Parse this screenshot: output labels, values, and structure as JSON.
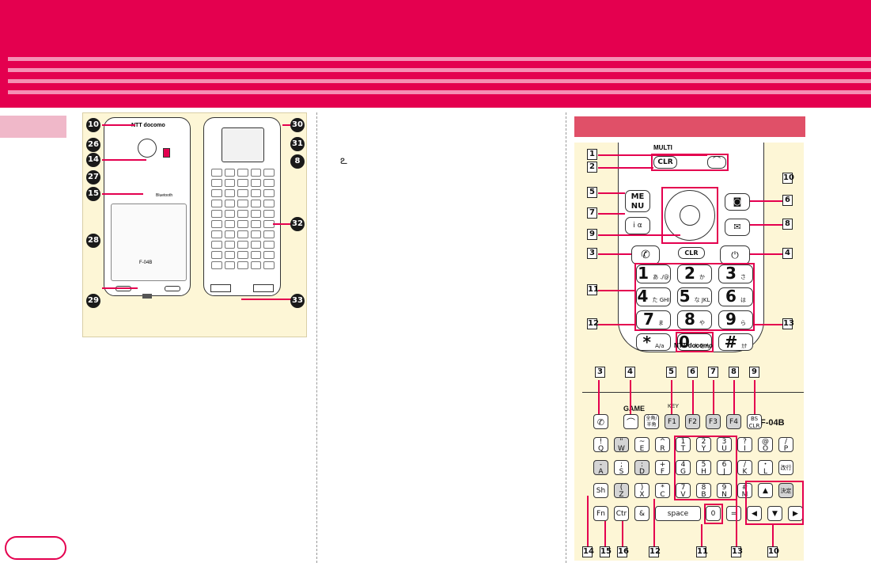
{
  "page": {
    "model_label_back": "F-04B",
    "brand_label": "NTT docomo",
    "bluetooth_label": "Bluetooth",
    "multi_label": "MULTI",
    "keyboard_model": "F-04B"
  },
  "back_view_callouts": [
    {
      "n": "10"
    },
    {
      "n": "26"
    },
    {
      "n": "14"
    },
    {
      "n": "27"
    },
    {
      "n": "15"
    },
    {
      "n": "28"
    },
    {
      "n": "29"
    },
    {
      "n": "30"
    },
    {
      "n": "31"
    },
    {
      "n": "8"
    },
    {
      "n": "32"
    },
    {
      "n": "33"
    }
  ],
  "keypad_tags": {
    "t1": "1",
    "t2": "2",
    "t3": "3",
    "t4": "4",
    "t5": "5",
    "t6": "6",
    "t7": "7",
    "t8": "8",
    "t9": "9",
    "t10": "10",
    "t11": "11",
    "t12": "12",
    "t13": "13"
  },
  "keypad_keys": {
    "clr": "CLR",
    "menu": "ME NU",
    "clr2": "CLR",
    "k1": "1",
    "k2": "2",
    "k3": "3",
    "k4": "4",
    "k5": "5",
    "k6": "6",
    "k7": "7",
    "k8": "8",
    "k9": "9",
    "k0": "0",
    "kstar": "*",
    "khash": "#",
    "sub1": "あ ./@",
    "sub2": "か ABC",
    "sub3": "さ DEF",
    "sub4": "た GHI",
    "sub5": "な JKL",
    "sub6": "は MNO",
    "sub7": "ま PQRS",
    "sub8": "や TUV",
    "sub9": "ら WXYZ",
    "sub0": "わをん",
    "substar": "A/a",
    "subhash": "ｶﾅ"
  },
  "qwerty_tags": {
    "q3": "3",
    "q4": "4",
    "q5": "5",
    "q6": "6",
    "q7": "7",
    "q8": "8",
    "q9": "9",
    "b14": "14",
    "b15": "15",
    "b16": "16",
    "b12": "12",
    "b11": "11",
    "b13": "13",
    "b10": "10"
  },
  "qwerty": {
    "game_label": "GAME",
    "key_label": "KEY",
    "zenkaku": "全角/半角",
    "f1": "F1",
    "f2": "F2",
    "f3": "F3",
    "f4": "F4",
    "bs": "BS CLR",
    "row1": [
      "Q",
      "W",
      "E",
      "R",
      "T",
      "Y",
      "U",
      "I",
      "O",
      "P"
    ],
    "row1_top": [
      "!",
      "\"",
      "~",
      "^",
      "1",
      "2",
      "3",
      "?",
      "@",
      "/"
    ],
    "row2": [
      "A",
      "S",
      "D",
      "F",
      "G",
      "H",
      "J",
      "K",
      "L",
      "改行"
    ],
    "row2_top": [
      "-",
      ";",
      ":",
      "+",
      "4",
      "5",
      "6",
      "/",
      "・",
      ""
    ],
    "row3": [
      "Sh",
      "Z",
      "X",
      "C",
      "V",
      "B",
      "N",
      "M",
      "▲",
      "決定"
    ],
    "row3_top": [
      "",
      "(",
      ")",
      "*",
      "7",
      "8",
      "9",
      "#",
      "",
      ""
    ],
    "row4": [
      "Fn",
      "Ctr",
      "&",
      "space",
      "0",
      "=",
      "◀",
      "▼",
      "▶"
    ],
    "row4_top": [
      "",
      "",
      "&",
      "",
      "0",
      "-",
      "",
      "",
      ""
    ]
  }
}
